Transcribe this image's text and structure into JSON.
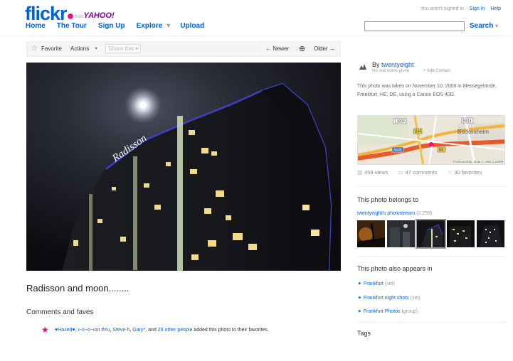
{
  "header": {
    "logo_text": "flickr",
    "logo_from": "from",
    "logo_yahoo": "YAHOO!",
    "signin_status": "You aren't signed in",
    "signin_label": "Sign In",
    "help_label": "Help",
    "search_label": "Search",
    "search_value": ""
  },
  "nav": {
    "home": "Home",
    "tour": "The Tour",
    "signup": "Sign Up",
    "explore": "Explore",
    "upload": "Upload"
  },
  "toolbar": {
    "favorite": "Favorite",
    "actions": "Actions",
    "share": "Share this",
    "newer": "← Newer",
    "older": "Older →"
  },
  "photo": {
    "title": "Radisson and moon........",
    "sign_text": "Radisson"
  },
  "comments": {
    "heading": "Comments and faves",
    "faves_users": [
      "♥Hazed♥",
      "i~o~o~ion thru",
      "Steve-h",
      "Gary*"
    ],
    "faves_sep1": ", ",
    "faves_and": ", and ",
    "faves_others": "26 other people",
    "faves_suffix": " added this photo to their favorites."
  },
  "owner": {
    "by": "By",
    "name": "twentyeight",
    "real_name": "No real name given",
    "add_contact": "+ Add Contact",
    "taken_text": "This photo was taken on November 10, 2008 in Messegelände, Frankfurt, HE, DE, using a Canon EOS 40D."
  },
  "map": {
    "place": "Bockenheim",
    "copyright": "©Yahoo!2010, Data © AND (c)2009",
    "roads": [
      "L3005",
      "B44",
      "A648",
      "B8",
      "K814"
    ]
  },
  "stats": {
    "views": "459 views",
    "comments": "47 comments",
    "favorites": "30 favorites"
  },
  "belongs": {
    "heading": "This photo belongs to",
    "stream_label": "twentyeight's photostream",
    "stream_count": "(2,259)"
  },
  "appears": {
    "heading": "This photo also appears in",
    "items": [
      {
        "name": "Frankfurt",
        "kind": "(set)"
      },
      {
        "name": "Frankfurt night shots",
        "kind": "(set)"
      },
      {
        "name": "Frankfurt Photos",
        "kind": "(group)"
      }
    ]
  },
  "tags": {
    "heading": "Tags"
  },
  "colors": {
    "flickr_blue": "#0063dc",
    "flickr_pink": "#ff0084"
  }
}
